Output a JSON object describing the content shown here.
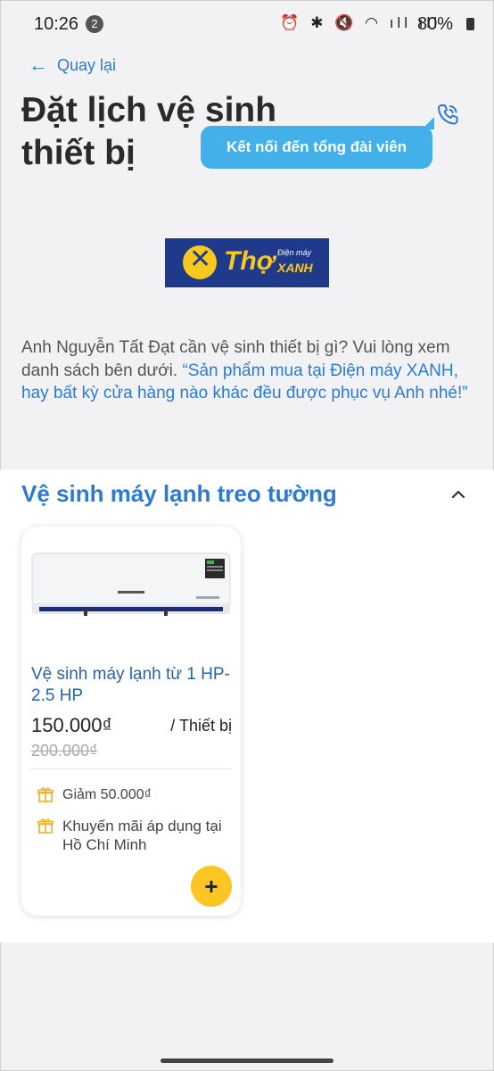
{
  "status_bar": {
    "time": "10:26",
    "notification_count": "2",
    "icons": "⏰ ✱ 🔇 ◠ ıll ıll",
    "battery": "80%"
  },
  "nav": {
    "back_label": "Quay lại"
  },
  "header": {
    "title": "Đặt lịch vệ sinh thiết bị",
    "call_button": "Kết nối đến tổng đài viên"
  },
  "logo": {
    "brand": "Thợ",
    "subtitle_top": "Điện máy",
    "subtitle_bottom": "XANH"
  },
  "intro": {
    "text": "Anh Nguyễn Tất Đạt cần vệ sinh thiết bị gì? Vui lòng xem danh sách bên dưới. ",
    "quote": "“Sản phẩm mua tại Điện máy XANH, hay bất kỳ cửa hàng nào khác đều được phục vụ Anh nhé!”"
  },
  "section": {
    "title": "Vệ sinh máy lạnh treo tường",
    "cards": [
      {
        "name": "Vệ sinh máy lạnh từ 1 HP-2.5 HP",
        "price": "150.000₫",
        "unit": "/ Thiết bị",
        "old_price": "200.000₫",
        "promos": [
          "Giảm 50.000₫",
          "Khuyến mãi áp dụng tại Hồ Chí Minh"
        ],
        "add_label": "+"
      }
    ]
  },
  "colors": {
    "accent": "#2b7bd4",
    "call_bubble": "#43b0ea",
    "add_button": "#fbc624"
  }
}
